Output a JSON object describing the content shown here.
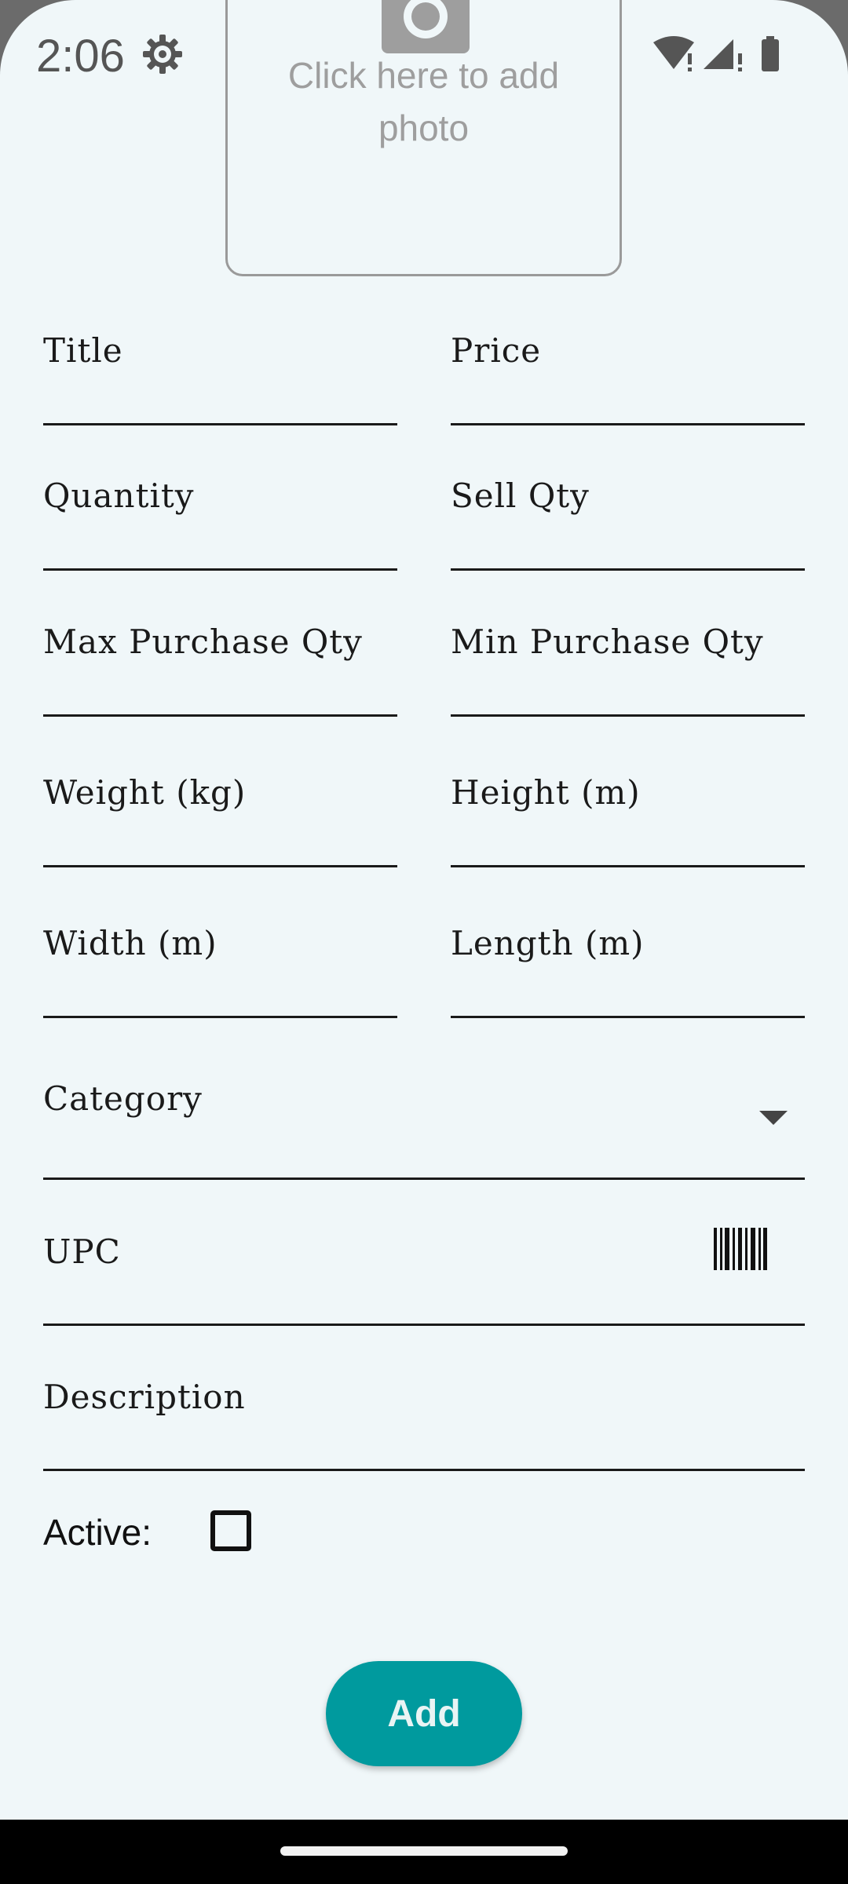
{
  "status_bar": {
    "time": "2:06"
  },
  "photo": {
    "prompt": "Click here to add\nphoto"
  },
  "form": {
    "title_label": "Title",
    "price_label": "Price",
    "quantity_label": "Quantity",
    "sell_qty_label": "Sell Qty",
    "max_purchase_qty_label": "Max Purchase Qty",
    "min_purchase_qty_label": "Min Purchase Qty",
    "weight_label": "Weight (kg)",
    "height_label": "Height (m)",
    "width_label": "Width (m)",
    "length_label": "Length (m)",
    "category_label": "Category",
    "upc_label": "UPC",
    "description_label": "Description",
    "active_label": "Active:",
    "active_checked": false
  },
  "actions": {
    "add_label": "Add"
  },
  "colors": {
    "background": "#f0f7f9",
    "accent": "#009a9e"
  }
}
